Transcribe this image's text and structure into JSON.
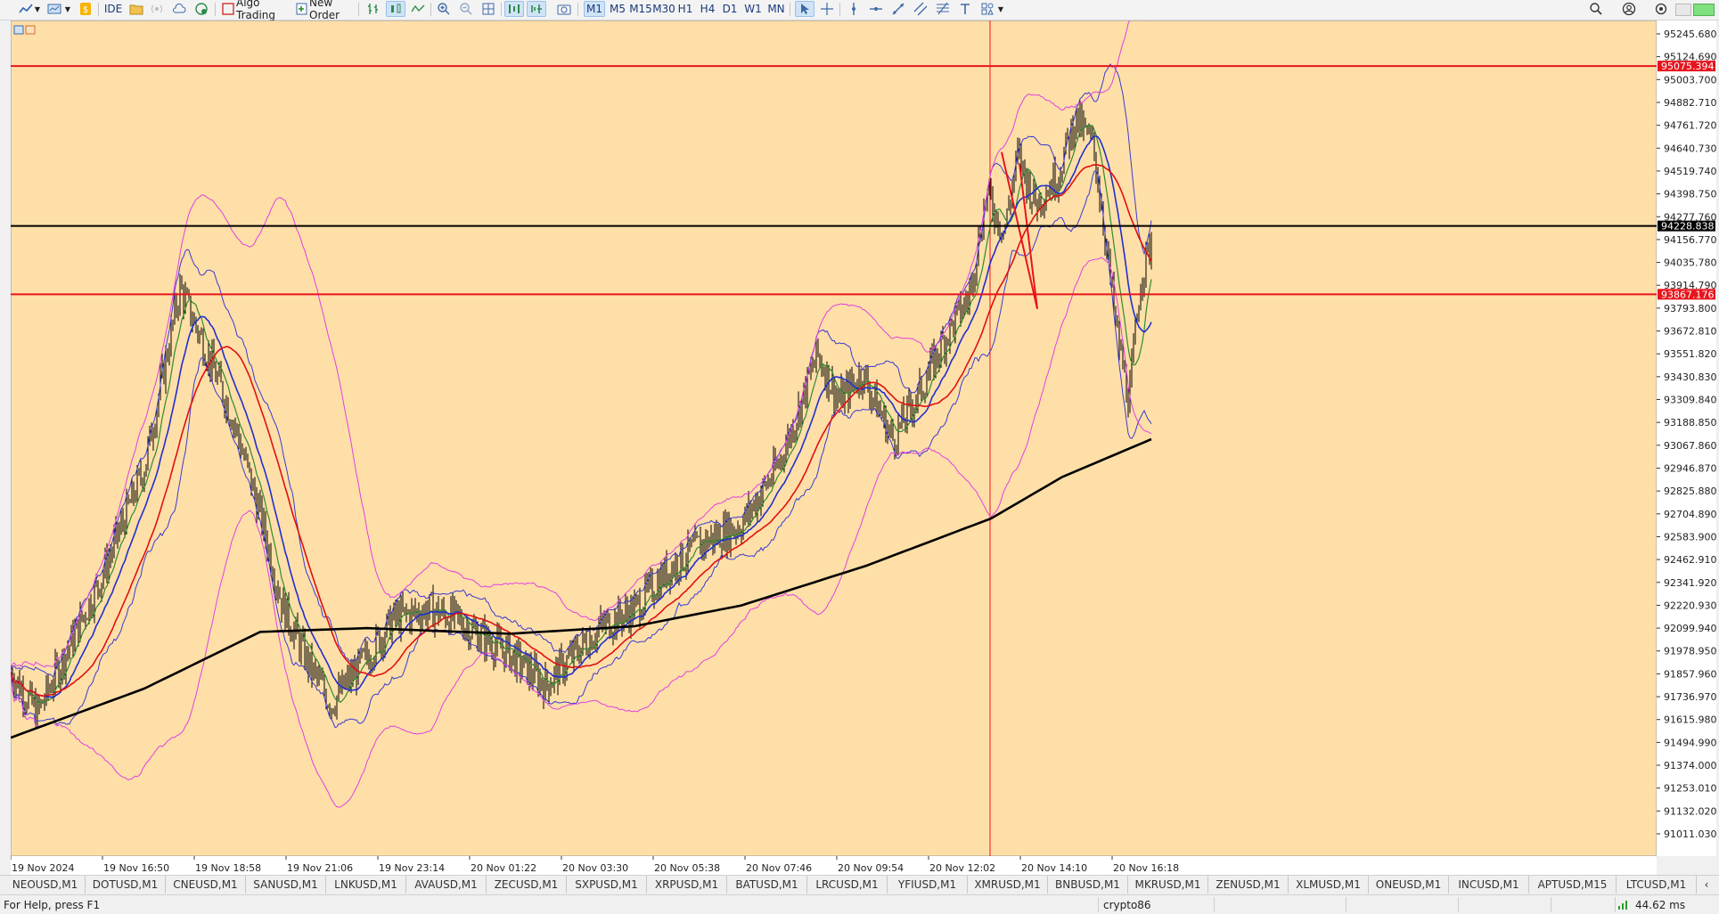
{
  "toolbar": {
    "ide_label": "IDE",
    "algo_label": "Algo Trading",
    "new_order_label": "New Order",
    "timeframes": [
      "M1",
      "M5",
      "M15",
      "M30",
      "H1",
      "H4",
      "D1",
      "W1",
      "MN"
    ],
    "active_timeframe": "M1"
  },
  "chart": {
    "background": "#ffdfa8",
    "price_labels": [
      "95245.680",
      "95124.690",
      "95003.700",
      "94882.710",
      "94761.720",
      "94640.730",
      "94519.740",
      "94398.750",
      "94277.760",
      "94156.770",
      "94035.780",
      "93914.790",
      "93793.800",
      "93672.810",
      "93551.820",
      "93430.830",
      "93309.840",
      "93188.850",
      "93067.860",
      "92946.870",
      "92825.880",
      "92704.890",
      "92583.900",
      "92462.910",
      "92341.920",
      "92220.930",
      "92099.940",
      "91978.950",
      "91857.960",
      "91736.970",
      "91615.980",
      "91494.990",
      "91374.000",
      "91253.010",
      "91132.020",
      "91011.030"
    ],
    "time_labels": [
      "19 Nov 2024",
      "19 Nov 16:50",
      "19 Nov 18:58",
      "19 Nov 21:06",
      "19 Nov 23:14",
      "20 Nov 01:22",
      "20 Nov 03:30",
      "20 Nov 05:38",
      "20 Nov 07:46",
      "20 Nov 09:54",
      "20 Nov 12:02",
      "20 Nov 14:10",
      "20 Nov 16:18"
    ],
    "hlines": [
      {
        "price": "95075.394",
        "color": "#e8141c"
      },
      {
        "price": "94228.838",
        "color": "#000000"
      },
      {
        "price": "93867.176",
        "color": "#e8141c"
      }
    ],
    "colors": {
      "price": "#000000",
      "ma_fast": "#2e8b2e",
      "ma_mid": "#1f2fd0",
      "ma_slow": "#e01010",
      "ma_long": "#000000",
      "bands_inner": "#3a3ad0",
      "bands_outer": "#e040e0",
      "crosshair": "#e8141c"
    }
  },
  "symbol_tabs": [
    "NEOUSD,M1",
    "DOTUSD,M1",
    "CNEUSD,M1",
    "SANUSD,M1",
    "LNKUSD,M1",
    "AVAUSD,M1",
    "ZECUSD,M1",
    "SXPUSD,M1",
    "XRPUSD,M1",
    "BATUSD,M1",
    "LRCUSD,M1",
    "YFIUSD,M1",
    "XMRUSD,M1",
    "BNBUSD,M1",
    "MKRUSD,M1",
    "ZENUSD,M1",
    "XLMUSD,M1",
    "ONEUSD,M1",
    "INCUSD,M1",
    "APTUSD,M15",
    "LTCUSD,M1"
  ],
  "status": {
    "help": "For Help, press F1",
    "profile": "crypto86",
    "ping": "44.62 ms"
  }
}
